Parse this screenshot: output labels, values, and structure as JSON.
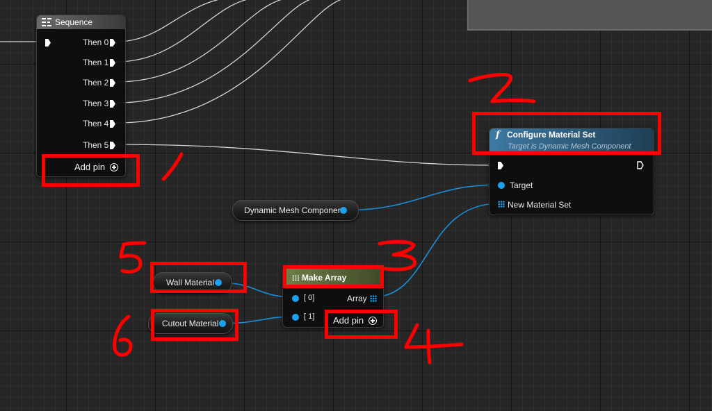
{
  "sequence_node": {
    "title": "Sequence",
    "outputs": [
      "Then 0",
      "Then 1",
      "Then 2",
      "Then 3",
      "Then 4",
      "Then 5"
    ],
    "add_pin_label": "Add pin"
  },
  "configure_node": {
    "title": "Configure Material Set",
    "subtitle": "Target is Dynamic Mesh Component",
    "inputs": [
      "Target",
      "New Material Set"
    ]
  },
  "dynamic_mesh_var": {
    "label": "Dynamic Mesh Component"
  },
  "make_array_node": {
    "title": "Make Array",
    "inputs": [
      "[ 0]",
      "[ 1]"
    ],
    "output_label": "Array",
    "add_pin_label": "Add pin"
  },
  "wall_material_var": {
    "label": "Wall Material"
  },
  "cutout_material_var": {
    "label": "Cutout Material"
  },
  "annotations": [
    "1",
    "2",
    "3",
    "4",
    "5",
    "6"
  ],
  "colors": {
    "annotation_red": "#ff0000",
    "object_pin_blue": "#1ea0f0",
    "exec_white": "#ffffff",
    "sequence_header": "#5a5a5a",
    "function_header": "#2d5a78",
    "make_array_header": "#5b6b3c"
  },
  "icons": {
    "sequence": "sequence-icon",
    "function": "function-icon",
    "make_array": "array-grid-icon",
    "add_pin": "plus-circle-icon"
  }
}
